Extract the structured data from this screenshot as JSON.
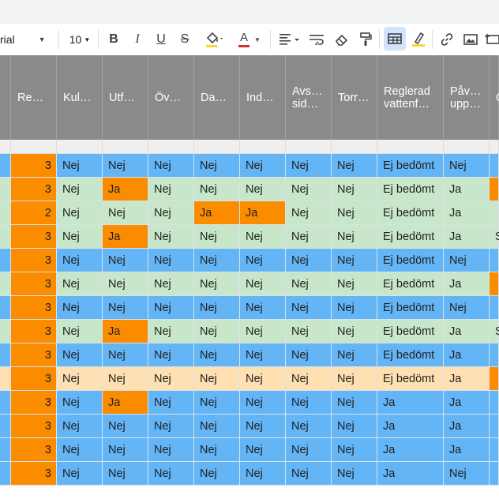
{
  "toolbar": {
    "font_name": "rial",
    "font_size": "10",
    "bold": "B",
    "italic": "I",
    "underline": "U",
    "strike": "S",
    "text_color_letter": "A"
  },
  "colors": {
    "blue": "#64b5f6",
    "green": "#c8e6c9",
    "peach": "#ffe0b2",
    "orange": "#fb8c00",
    "header": "#8a8a8a"
  },
  "headers": [
    "Re…",
    "Kul…",
    "Utf…",
    "Öv…",
    "Da…",
    "Ind…",
    "Avs…\nsid…",
    "Torr…",
    "Reglerad\nvattenf…",
    "Påv…\nupp…",
    "C"
  ],
  "rows": [
    {
      "bg": "blue",
      "cells": [
        "3",
        "Nej",
        "Nej",
        "Nej",
        "Nej",
        "Nej",
        "Nej",
        "Nej",
        "Ej bedömt",
        "Nej",
        ""
      ],
      "hi": []
    },
    {
      "bg": "green",
      "cells": [
        "3",
        "Nej",
        "Ja",
        "Nej",
        "Nej",
        "Nej",
        "Nej",
        "Nej",
        "Ej bedömt",
        "Ja",
        ""
      ],
      "hi": [
        2,
        10
      ]
    },
    {
      "bg": "green",
      "cells": [
        "2",
        "Nej",
        "Nej",
        "Nej",
        "Ja",
        "Ja",
        "Nej",
        "Nej",
        "Ej bedömt",
        "Ja",
        ""
      ],
      "hi": [
        4,
        5
      ]
    },
    {
      "bg": "green",
      "cells": [
        "3",
        "Nej",
        "Ja",
        "Nej",
        "Nej",
        "Nej",
        "Nej",
        "Nej",
        "Ej bedömt",
        "Ja",
        "S"
      ],
      "hi": [
        2
      ]
    },
    {
      "bg": "blue",
      "cells": [
        "3",
        "Nej",
        "Nej",
        "Nej",
        "Nej",
        "Nej",
        "Nej",
        "Nej",
        "Ej bedömt",
        "Nej",
        ""
      ],
      "hi": []
    },
    {
      "bg": "green",
      "cells": [
        "3",
        "Nej",
        "Nej",
        "Nej",
        "Nej",
        "Nej",
        "Nej",
        "Nej",
        "Ej bedömt",
        "Ja",
        ""
      ],
      "hi": [
        10
      ]
    },
    {
      "bg": "blue",
      "cells": [
        "3",
        "Nej",
        "Nej",
        "Nej",
        "Nej",
        "Nej",
        "Nej",
        "Nej",
        "Ej bedömt",
        "Nej",
        ""
      ],
      "hi": []
    },
    {
      "bg": "green",
      "cells": [
        "3",
        "Nej",
        "Ja",
        "Nej",
        "Nej",
        "Nej",
        "Nej",
        "Nej",
        "Ej bedömt",
        "Ja",
        "S"
      ],
      "hi": [
        2
      ]
    },
    {
      "bg": "blue",
      "cells": [
        "3",
        "Nej",
        "Nej",
        "Nej",
        "Nej",
        "Nej",
        "Nej",
        "Nej",
        "Ej bedömt",
        "Ja",
        ""
      ],
      "hi": []
    },
    {
      "bg": "peach",
      "cells": [
        "3",
        "Nej",
        "Nej",
        "Nej",
        "Nej",
        "Nej",
        "Nej",
        "Nej",
        "Ej bedömt",
        "Ja",
        ""
      ],
      "hi": [
        10
      ]
    },
    {
      "bg": "blue",
      "cells": [
        "3",
        "Nej",
        "Ja",
        "Nej",
        "Nej",
        "Nej",
        "Nej",
        "Nej",
        "Ja",
        "Ja",
        ""
      ],
      "hi": [
        2
      ]
    },
    {
      "bg": "blue",
      "cells": [
        "3",
        "Nej",
        "Nej",
        "Nej",
        "Nej",
        "Nej",
        "Nej",
        "Nej",
        "Ja",
        "Ja",
        ""
      ],
      "hi": []
    },
    {
      "bg": "blue",
      "cells": [
        "3",
        "Nej",
        "Nej",
        "Nej",
        "Nej",
        "Nej",
        "Nej",
        "Nej",
        "Ja",
        "Ja",
        ""
      ],
      "hi": []
    },
    {
      "bg": "blue",
      "cells": [
        "3",
        "Nej",
        "Nej",
        "Nej",
        "Nej",
        "Nej",
        "Nej",
        "Nej",
        "Ja",
        "Nej",
        ""
      ],
      "hi": []
    }
  ]
}
